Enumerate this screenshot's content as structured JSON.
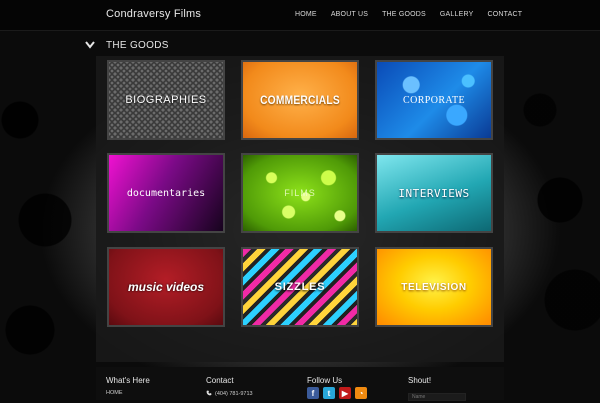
{
  "brand": "Condraversy Films",
  "nav": [
    "HOME",
    "ABOUT US",
    "THE GOODS",
    "GALLERY",
    "CONTACT"
  ],
  "section_title": "THE GOODS",
  "tiles": [
    {
      "label": "BIOGRAPHIES"
    },
    {
      "label": "COMMERCIALS"
    },
    {
      "label": "CORPORATE"
    },
    {
      "label": "documentaries"
    },
    {
      "label": "FILMS"
    },
    {
      "label": "INTERVIEWS"
    },
    {
      "label": "music videos"
    },
    {
      "label": "SIZZLES"
    },
    {
      "label": "TELEVISION"
    }
  ],
  "footer": {
    "whats_here": {
      "title": "What's Here",
      "first_link": "HOME"
    },
    "contact": {
      "title": "Contact",
      "phone": "(404) 781-9713"
    },
    "follow": {
      "title": "Follow Us",
      "icons": [
        "facebook-icon",
        "twitter-icon",
        "youtube-icon",
        "rss-icon"
      ]
    },
    "shout": {
      "title": "Shout!",
      "placeholder": "Name"
    }
  }
}
